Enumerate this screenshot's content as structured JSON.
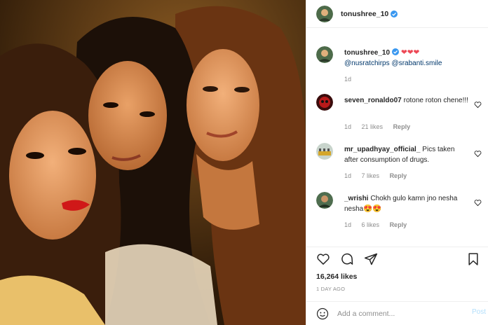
{
  "post": {
    "author": "tonushree_10",
    "caption_mentions": [
      "@nusratchirps",
      "@srabanti.smile"
    ],
    "caption_hearts": "❤❤❤",
    "caption_age": "1d",
    "likes_count": "16,264 likes",
    "posted_ago": "1 DAY AGO"
  },
  "comments": [
    {
      "username": "seven_ronaldo07",
      "text": "rotone roton chene!!!",
      "age": "1d",
      "likes": "21 likes",
      "reply": "Reply"
    },
    {
      "username": "mr_upadhyay_official_",
      "text": "Pics taken after consumption of drugs.",
      "age": "1d",
      "likes": "7 likes",
      "reply": "Reply"
    },
    {
      "username": "_wrishi",
      "text": "Chokh gulo kamn jno nesha nesha",
      "emoji": "😍😍",
      "age": "1d",
      "likes": "6 likes",
      "reply": "Reply"
    }
  ],
  "add_comment": {
    "placeholder": "Add a comment...",
    "post_label": "Post"
  },
  "icons": [
    "verified-badge-icon",
    "heart-icon",
    "comment-icon",
    "share-icon",
    "bookmark-icon",
    "emoji-icon"
  ],
  "colors": {
    "verified": "#3897f0",
    "mention": "#00376b",
    "muted": "#8e8e8e",
    "post_button": "#b2dffc",
    "heart_red": "#ed4956"
  }
}
